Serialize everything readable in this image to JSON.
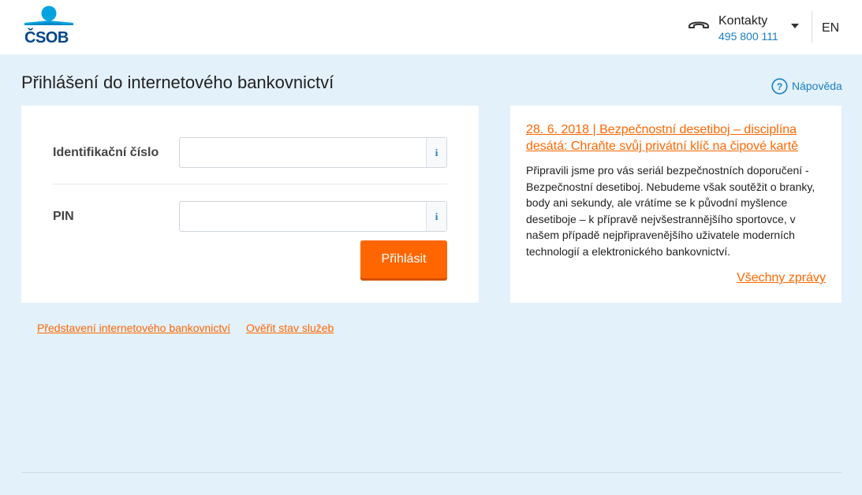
{
  "header": {
    "logo_text": "ČSOB",
    "contacts_label": "Kontakty",
    "contacts_number": "495 800 111",
    "language": "EN"
  },
  "page": {
    "title": "Přihlášení do internetového bankovnictví",
    "help_label": "Nápověda"
  },
  "login": {
    "id_label": "Identifikační číslo",
    "id_value": "",
    "pin_label": "PIN",
    "pin_value": "",
    "info_glyph": "i",
    "submit_label": "Přihlásit"
  },
  "news": {
    "title": "28. 6. 2018 | Bezpečnostní desetiboj – disciplína desátá: Chraňte svůj privátní klíč na čipové kartě",
    "body": "Připravili jsme pro vás seriál bezpečnostních doporučení - Bezpečnostní desetiboj. Nebudeme však soutěžit o branky, body ani sekundy, ale vrátíme se k původní myšlence desetiboje – k přípravě nejvšestrannějšího sportovce, v našem případě nejpřipravenějšího uživatele moderních technologií a elektronického bankovnictví.",
    "all_news_label": "Všechny zprávy"
  },
  "links": {
    "intro": "Představení internetového bankovnictví",
    "status": "Ověřit stav služeb"
  },
  "colors": {
    "accent": "#ff6600",
    "link_blue": "#1a7fc1",
    "brand_blue": "#00468c",
    "logo_cyan": "#00a3e0",
    "background": "#e3f1fb"
  },
  "icons": {
    "phone": "phone-icon",
    "caret": "chevron-down-icon",
    "help": "question-circle-icon",
    "info": "info-icon"
  }
}
